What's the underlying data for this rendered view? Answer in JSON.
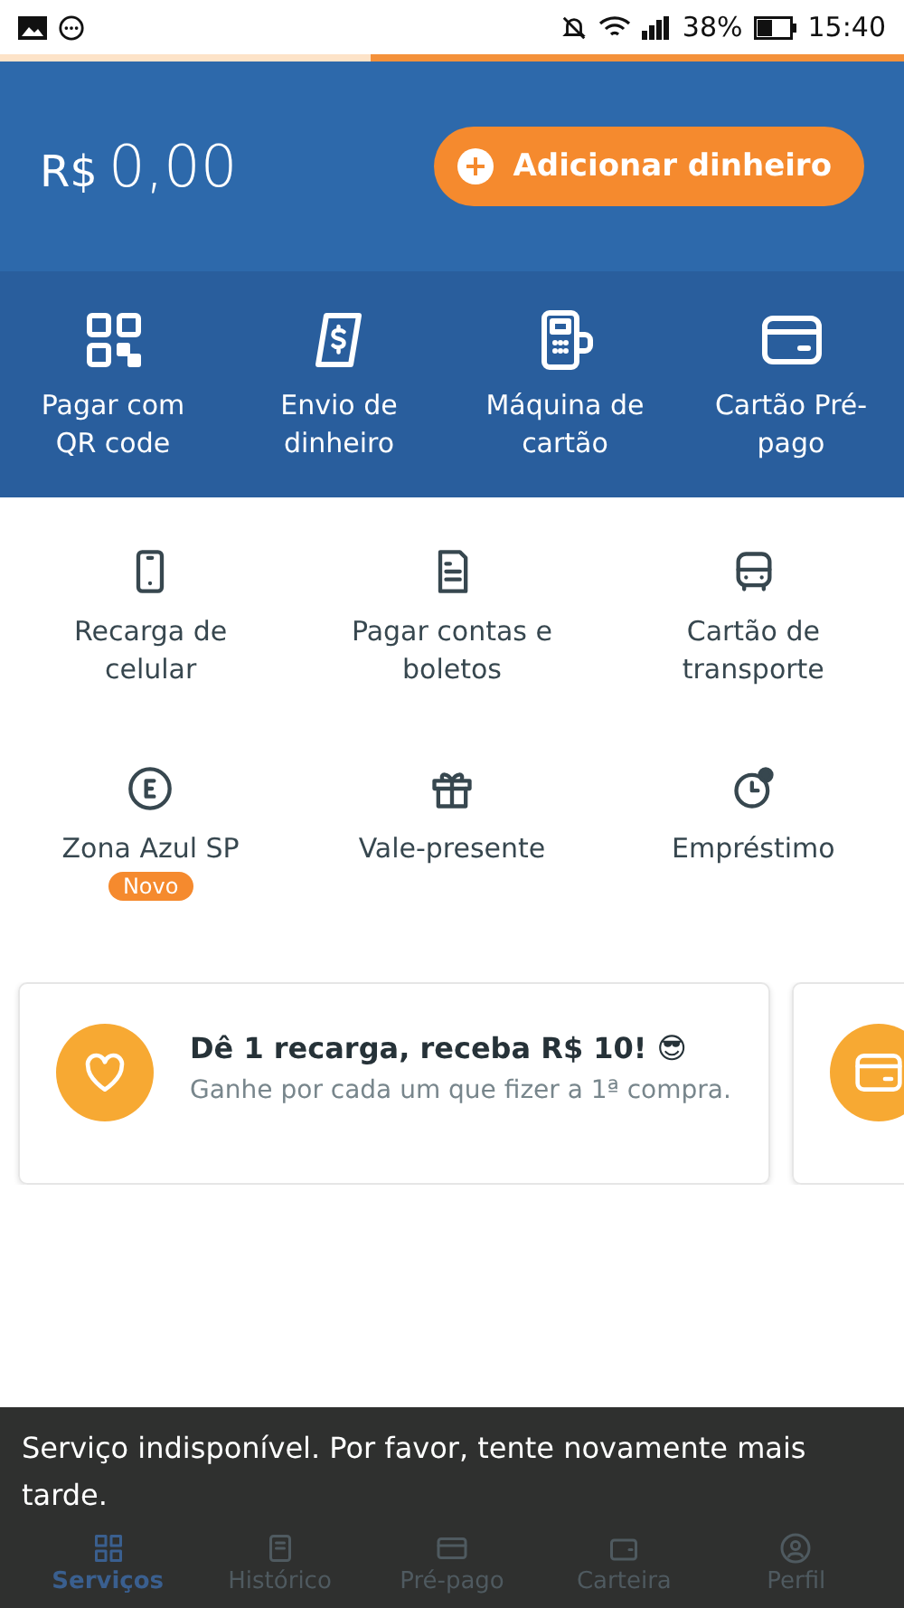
{
  "status_bar": {
    "battery": "38%",
    "time": "15:40"
  },
  "balance": {
    "currency": "R$",
    "amount": "0,00"
  },
  "add_money_button": {
    "label": "Adicionar dinheiro"
  },
  "quick_actions": [
    {
      "kind": "qr",
      "label": "Pagar com QR code"
    },
    {
      "kind": "transfer",
      "label": "Envio de dinheiro"
    },
    {
      "kind": "terminal",
      "label": "Máquina de cartão"
    },
    {
      "kind": "card",
      "label": "Cartão Pré-pago"
    }
  ],
  "services": [
    {
      "kind": "phone",
      "label": "Recarga de celular"
    },
    {
      "kind": "bill",
      "label": "Pagar contas e boletos"
    },
    {
      "kind": "bus",
      "label": "Cartão de transporte"
    },
    {
      "kind": "parking",
      "label": "Zona Azul SP",
      "badge": "Novo"
    },
    {
      "kind": "gift",
      "label": "Vale-presente"
    },
    {
      "kind": "loan",
      "label": "Empréstimo"
    }
  ],
  "promo_cards": [
    {
      "kind": "heart",
      "title": "Dê 1 recarga, receba R$ 10! 😎",
      "subtitle": "Ganhe por cada um que fizer a 1ª compra."
    },
    {
      "kind": "card"
    }
  ],
  "snackbar": {
    "message": "Serviço indisponível. Por favor, tente novamente mais tarde."
  },
  "bottom_nav": [
    {
      "kind": "services",
      "label": "Serviços",
      "selected": true
    },
    {
      "kind": "history",
      "label": "Histórico",
      "selected": false
    },
    {
      "kind": "prepaid",
      "label": "Pré-pago",
      "selected": false
    },
    {
      "kind": "wallet",
      "label": "Carteira",
      "selected": false
    },
    {
      "kind": "profile",
      "label": "Perfil",
      "selected": false
    }
  ]
}
